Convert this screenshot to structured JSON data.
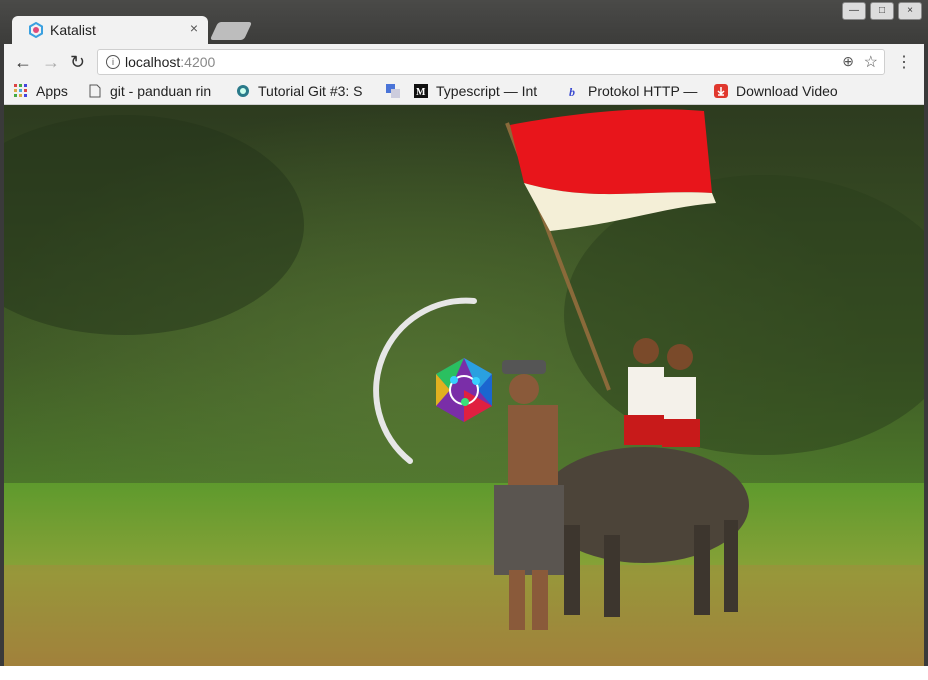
{
  "tab": {
    "title": "Katalist",
    "close": "×"
  },
  "window_controls": [
    "—",
    "□",
    "×"
  ],
  "address": {
    "host": "localhost",
    "port": ":4200"
  },
  "bookmarks": [
    {
      "label": "Apps",
      "icon": "apps-icon"
    },
    {
      "label": "git - panduan rin",
      "icon": "page-icon"
    },
    {
      "label": "Tutorial Git #3: S",
      "icon": "globe-icon"
    },
    {
      "label": "",
      "icon": "translate-icon"
    },
    {
      "label": "Typescript — Int",
      "icon": "medium-icon"
    },
    {
      "label": "Protokol HTTP —",
      "icon": "b-icon"
    },
    {
      "label": "Download Video",
      "icon": "download-icon"
    }
  ],
  "colors": {
    "flag_red": "#e8151b",
    "flag_white": "#f4efd7",
    "spinner": "#e6e6e6"
  },
  "icons": [
    "info-icon",
    "zoom-icon",
    "star-icon",
    "menu-icon",
    "back-icon",
    "forward-icon",
    "reload-icon",
    "katalist-logo-icon"
  ]
}
